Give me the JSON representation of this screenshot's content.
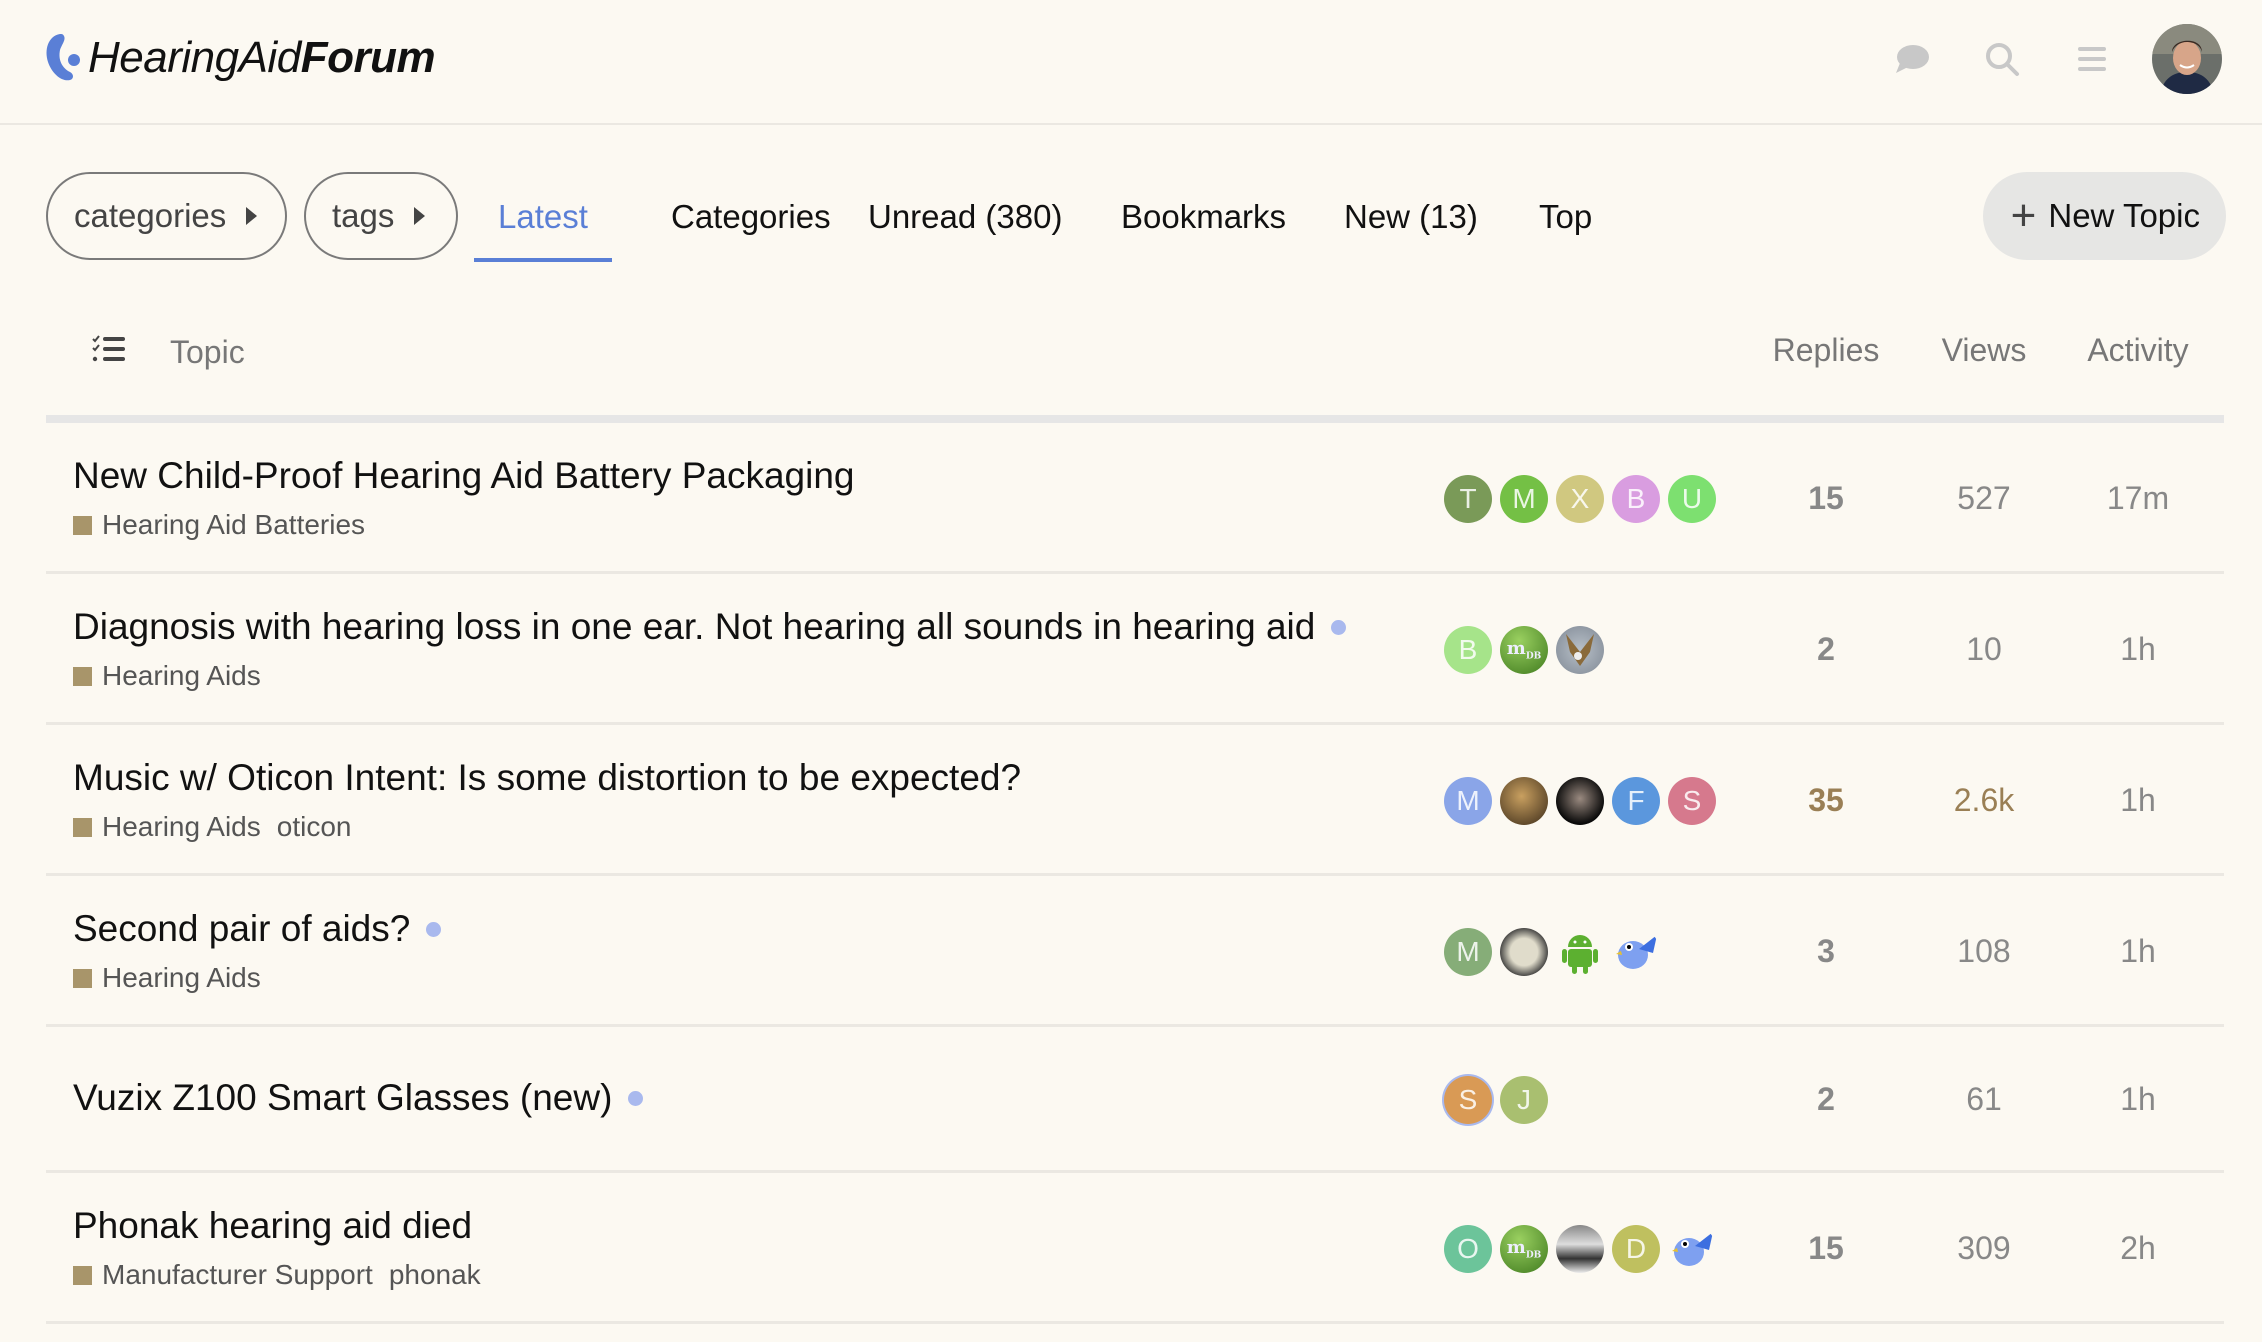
{
  "site": {
    "name_regular": "HearingAid",
    "name_bold": "Forum",
    "accent_color": "#5a7fd6"
  },
  "header_icons": [
    "chat-icon",
    "search-icon",
    "hamburger-menu-icon",
    "user-avatar"
  ],
  "nav": {
    "categories_dropdown": "categories",
    "tags_dropdown": "tags",
    "tabs": [
      {
        "label": "Latest",
        "active": true
      },
      {
        "label": "Categories",
        "active": false
      },
      {
        "label": "Unread (380)",
        "active": false
      },
      {
        "label": "Bookmarks",
        "active": false
      },
      {
        "label": "New (13)",
        "active": false
      },
      {
        "label": "Top",
        "active": false
      }
    ],
    "new_topic_label": "New Topic"
  },
  "table": {
    "columns": {
      "topic": "Topic",
      "replies": "Replies",
      "views": "Views",
      "activity": "Activity"
    },
    "topics": [
      {
        "title": "New Child-Proof Hearing Aid Battery Packaging",
        "unread_dot": false,
        "category": "Hearing Aid Batteries",
        "tags": [],
        "posters": [
          {
            "letter": "T",
            "color": "#7a9a58"
          },
          {
            "letter": "M",
            "color": "#74c045"
          },
          {
            "letter": "X",
            "color": "#d0c880"
          },
          {
            "letter": "B",
            "color": "#d99de0"
          },
          {
            "letter": "U",
            "color": "#7de070"
          }
        ],
        "replies": "15",
        "views": "527",
        "activity": "17m",
        "hot": false
      },
      {
        "title": "Diagnosis with hearing loss in one ear. Not hearing all sounds in hearing aid",
        "unread_dot": true,
        "category": "Hearing Aids",
        "tags": [],
        "posters": [
          {
            "letter": "B",
            "color": "#a6e48a"
          },
          {
            "letter": "mDB",
            "color": "#5a9a30",
            "image": "green-mdb-avatar"
          },
          {
            "letter": "",
            "color": "#9aa3b0",
            "image": "eagle-avatar"
          }
        ],
        "replies": "2",
        "views": "10",
        "activity": "1h",
        "hot": false
      },
      {
        "title": "Music w/ Oticon Intent: Is some distortion to be expected?",
        "unread_dot": false,
        "category": "Hearing Aids",
        "tags": [
          "oticon"
        ],
        "posters": [
          {
            "letter": "M",
            "color": "#8aa5e8"
          },
          {
            "letter": "",
            "color": "#6a5030",
            "image": "photo-avatar"
          },
          {
            "letter": "",
            "color": "#1a1a1a",
            "image": "photo-avatar-dark"
          },
          {
            "letter": "F",
            "color": "#5b97dd"
          },
          {
            "letter": "S",
            "color": "#d6798d"
          }
        ],
        "replies": "35",
        "views": "2.6k",
        "activity": "1h",
        "hot": true
      },
      {
        "title": "Second pair of aids?",
        "unread_dot": true,
        "category": "Hearing Aids",
        "tags": [],
        "posters": [
          {
            "letter": "M",
            "color": "#86ad78"
          },
          {
            "letter": "",
            "color": "#777055",
            "image": "coin-avatar"
          },
          {
            "letter": "",
            "color": "#5cb030",
            "image": "android-avatar"
          },
          {
            "letter": "",
            "color": "#3d6fe0",
            "image": "bluebird-avatar"
          }
        ],
        "replies": "3",
        "views": "108",
        "activity": "1h",
        "hot": false
      },
      {
        "title": "Vuzix Z100 Smart Glasses (new)",
        "unread_dot": true,
        "category": "",
        "tags": [],
        "posters": [
          {
            "letter": "S",
            "color": "#d99a55",
            "ring": true
          },
          {
            "letter": "J",
            "color": "#a9bf70"
          }
        ],
        "replies": "2",
        "views": "61",
        "activity": "1h",
        "hot": false
      },
      {
        "title": "Phonak hearing aid died",
        "unread_dot": false,
        "category": "Manufacturer Support",
        "tags": [
          "phonak"
        ],
        "posters": [
          {
            "letter": "O",
            "color": "#6cc49a"
          },
          {
            "letter": "mDB",
            "color": "#5a9a30",
            "image": "green-mdb-avatar"
          },
          {
            "letter": "",
            "color": "#666666",
            "image": "photo-avatar-bw"
          },
          {
            "letter": "D",
            "color": "#bfc05f"
          },
          {
            "letter": "",
            "color": "#3d6fe0",
            "image": "bluebird-avatar"
          }
        ],
        "replies": "15",
        "views": "309",
        "activity": "2h",
        "hot": false
      }
    ]
  }
}
